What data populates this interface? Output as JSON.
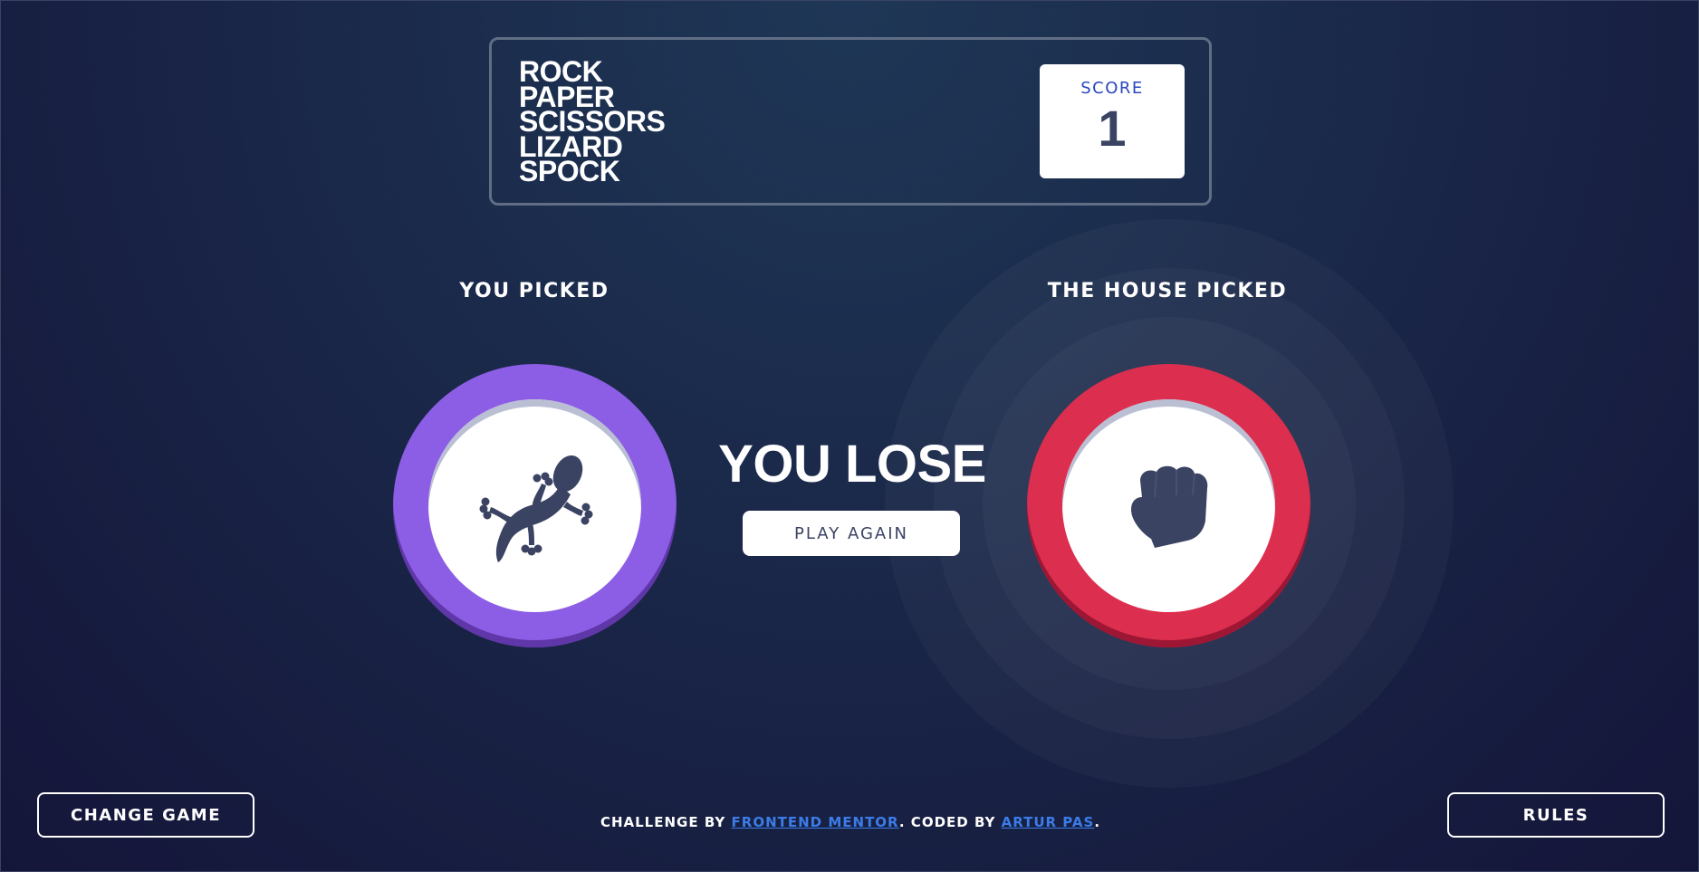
{
  "header": {
    "logo_lines": [
      "ROCK",
      "PAPER",
      "SCISSORS",
      "LIZARD",
      "SPOCK"
    ],
    "score_label": "SCORE",
    "score_value": "1"
  },
  "game": {
    "you_picked_label": "YOU PICKED",
    "house_picked_label": "THE HOUSE PICKED",
    "you_pick": "lizard-icon",
    "house_pick": "rock-icon",
    "result_text": "YOU LOSE",
    "play_again_label": "PLAY AGAIN",
    "colors": {
      "lizard": "#8c5de5",
      "rock": "#dc2e4e",
      "icon": "#3b4363",
      "score_label": "#2a46c0"
    }
  },
  "footer": {
    "challenge_prefix": "CHALLENGE BY ",
    "challenge_link": "FRONTEND MENTOR",
    "coded_prefix": ". CODED BY ",
    "coded_link": "ARTUR PAS",
    "suffix": "."
  },
  "controls": {
    "change_game_label": "CHANGE GAME",
    "rules_label": "RULES"
  }
}
